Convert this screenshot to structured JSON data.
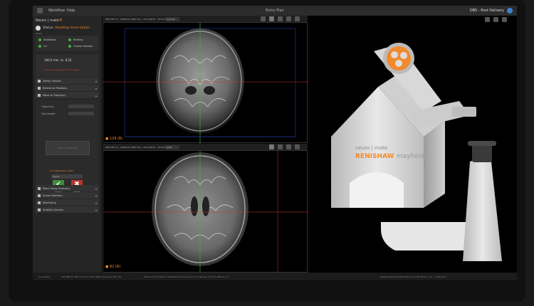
{
  "menubar": {
    "menu1": "Workflow",
    "menu2": "Help",
    "window_title": "Entry Plan",
    "stage": "DBS - Post Delivery"
  },
  "sidebar": {
    "brand_a": "Neuro | mate",
    "brand_b": "®",
    "status_label": "Status:",
    "status_value": "Awaiting move option",
    "status_sub": "Ready",
    "indicators": [
      {
        "label": "Stabilised",
        "color": "#3cb043"
      },
      {
        "label": "Braking",
        "color": "#3cb043"
      },
      {
        "label": "On",
        "color": "#3cb043"
      },
      {
        "label": "Correct Session",
        "color": "#3cb043"
      }
    ],
    "distance": "190.0 mm",
    "to": "to",
    "offset": "8.25",
    "tolerance": "Tolerance achieved to Full length",
    "sections": [
      {
        "label": "Safety Options"
      },
      {
        "label": "Reference Positions"
      },
      {
        "label": "Move to Trajectory"
      }
    ],
    "mt": {
      "trajectory_label": "Trajectory:",
      "tool_label": "Tool length:",
      "move_button": "Move to Trajectory",
      "confirm_label": "Is configuration valid?",
      "select_value": "Yellow",
      "confirm_btn": "Confirm",
      "cancel_btn": "Cancel"
    },
    "sections2": [
      {
        "label": "Move Along Trajectory"
      },
      {
        "label": "Screw Selection"
      },
      {
        "label": "Monitoring"
      },
      {
        "label": "Stability Options"
      }
    ]
  },
  "view_top": {
    "header": "DBS DBS T1 - MPRAGE (1MM ISO) - 2012/08/20 - 3M ISO/A ax",
    "dropdown": "Coronal",
    "zoom": "129",
    "unit": "(R)"
  },
  "view_bottom": {
    "header": "DBS DBS T1 - MPRAGE (1MM ISO) - 2012/08/20 - 3M ISO/A ax",
    "dropdown": "Axial",
    "zoom": "82",
    "unit": "(R)"
  },
  "robot": {
    "brand": "RENISHAW",
    "brand2": "mayfield",
    "product": "neuro | mate",
    "accent": "#f08a2c"
  },
  "bottombar": {
    "left": "Connected",
    "mid1": "Left DBS GT MRI 1.5 TS 1.2 SAG MPR Axial slice Tb1 100",
    "mid2": "Robot Link 10 Tried in Trajectory Tolerance: 0.5 mm (Range of 0.5 T) BW-L2 0 / 2",
    "right": "System Ready   2012/12/05 v1.0.4   PC Version 1.0 — Channel 2"
  }
}
